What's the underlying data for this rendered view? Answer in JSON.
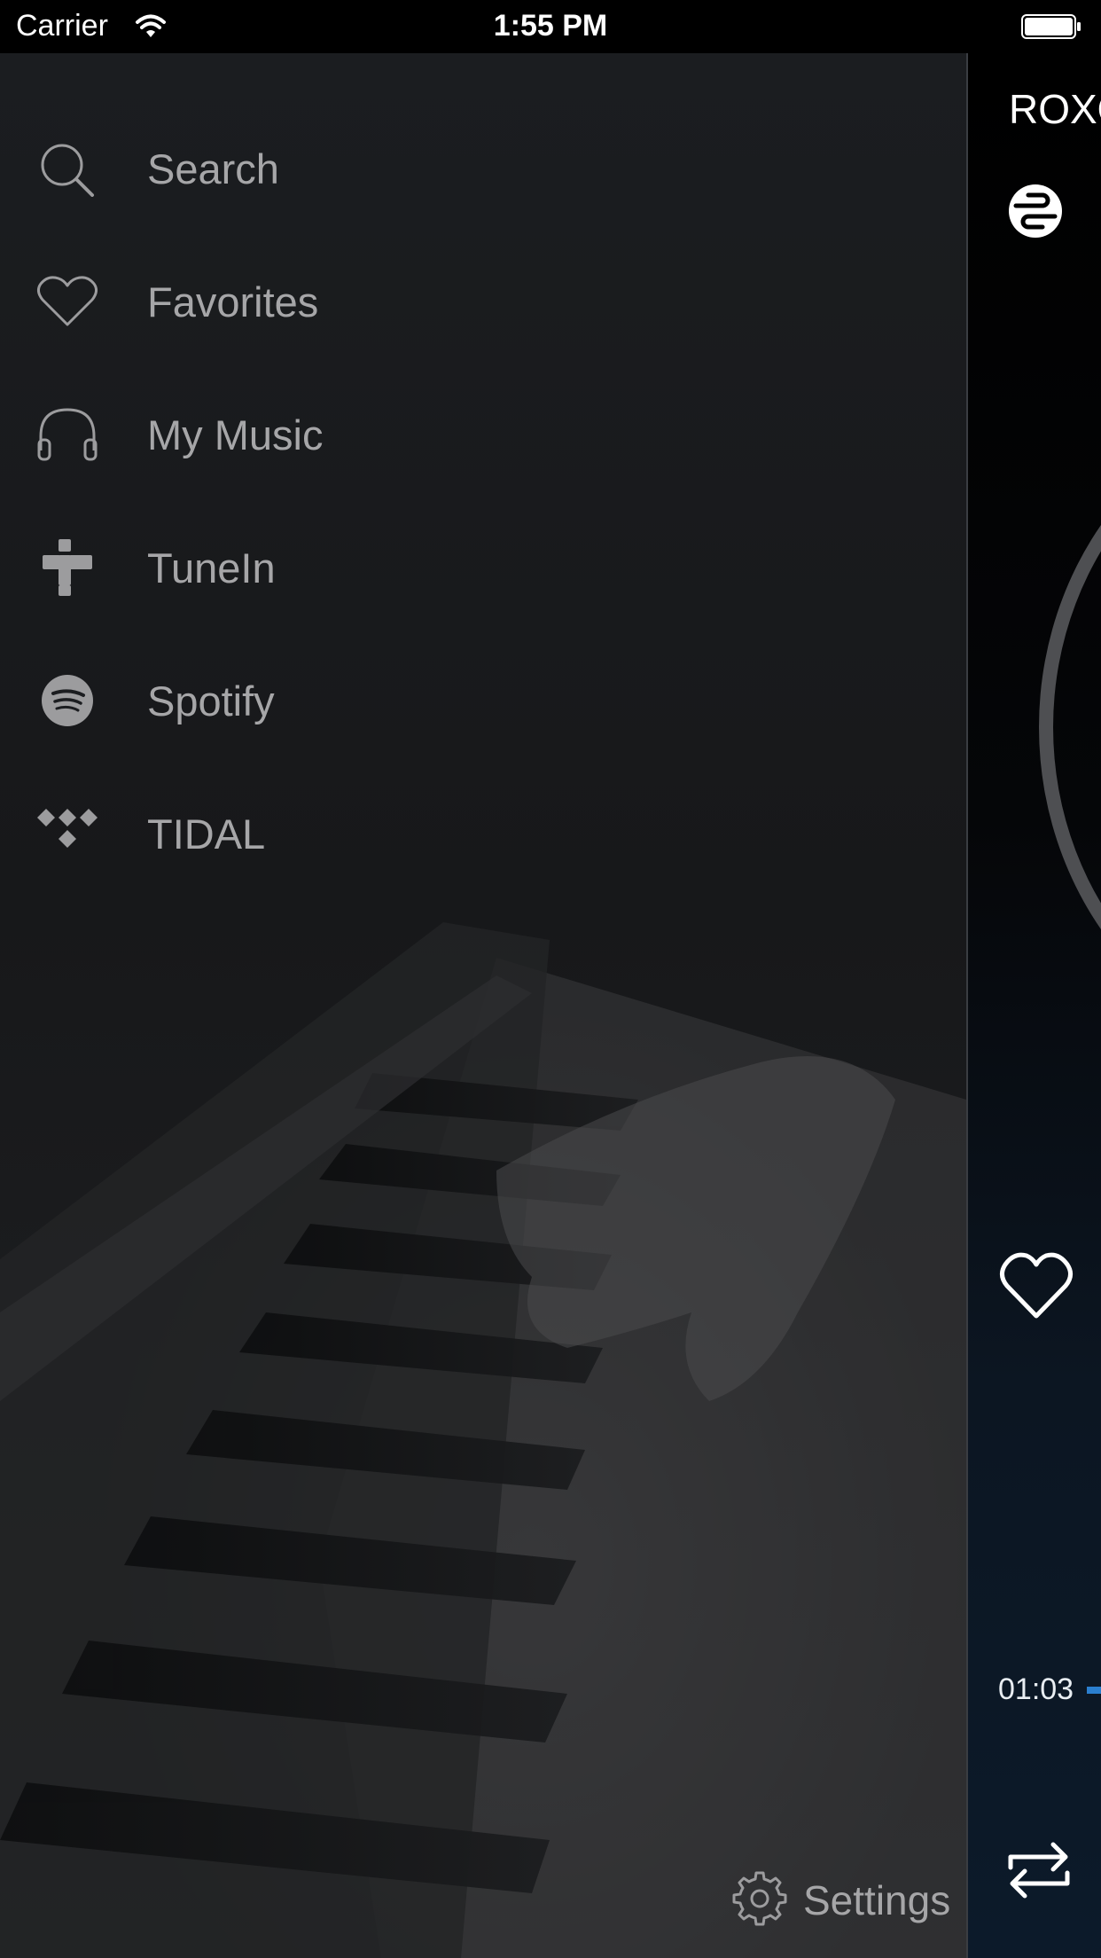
{
  "status_bar": {
    "carrier": "Carrier",
    "time": "1:55 PM"
  },
  "drawer": {
    "menu_items": [
      {
        "label": "Search",
        "icon": "search-icon"
      },
      {
        "label": "Favorites",
        "icon": "heart-icon"
      },
      {
        "label": "My Music",
        "icon": "headphones-icon"
      },
      {
        "label": "TuneIn",
        "icon": "tunein-icon"
      },
      {
        "label": "Spotify",
        "icon": "spotify-icon"
      },
      {
        "label": "TIDAL",
        "icon": "tidal-icon"
      }
    ],
    "settings_label": "Settings"
  },
  "now_playing": {
    "room_title": "ROXO",
    "elapsed": "01:03",
    "colors": {
      "progress": "#2b7fcf"
    }
  },
  "colors": {
    "menu_text": "#a6a6a8",
    "drawer_bg": "#1b1d20"
  }
}
